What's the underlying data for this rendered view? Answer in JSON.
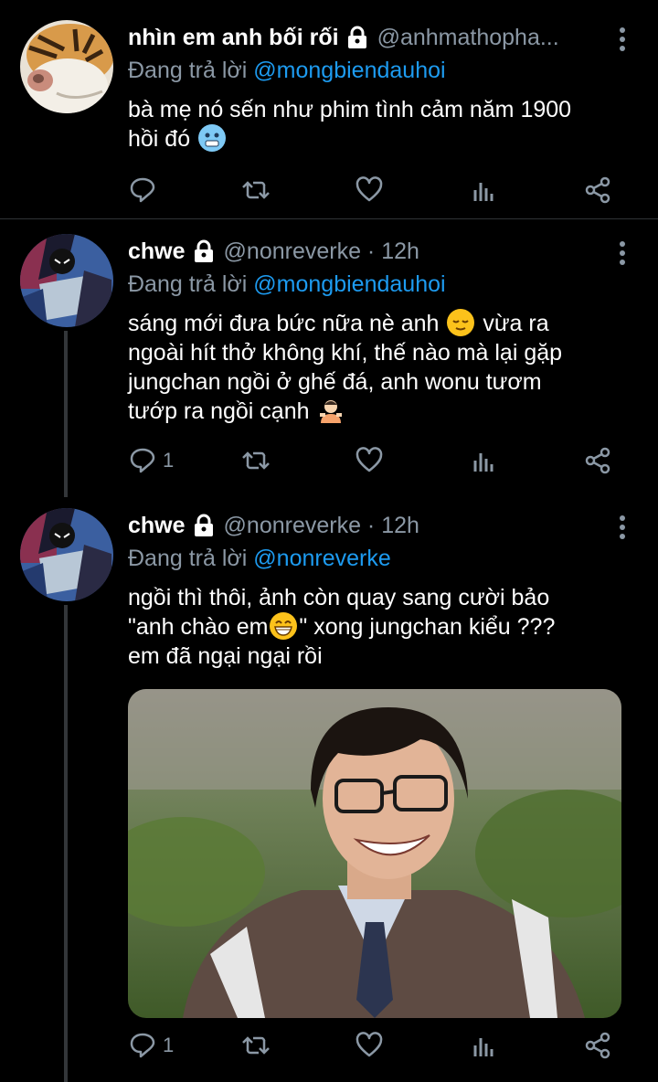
{
  "tweets": [
    {
      "name": "nhìn em anh bối rối",
      "handle": "@anhmathopha...",
      "time": "",
      "reply_prefix": "Đang trả lời",
      "reply_to": "@mongbiendauhoi",
      "text_lines": [
        "bà mẹ nó sến như phim tình cảm năm 1900",
        "hồi đó"
      ],
      "emoji": "cold-face",
      "reply_count": "",
      "avatar": "tiger-avatar"
    },
    {
      "name": "chwe",
      "handle": "@nonreverke · 12h",
      "reply_prefix": "Đang trả lời",
      "reply_to": "@mongbiendauhoi",
      "text_lines": [
        "sáng mới đưa bức nữa nè anh",
        "vừa ra",
        "ngoài hít thở không khí, thế nào mà lại gặp",
        "jungchan ngồi ở ghế đá, anh wonu tươm",
        "tướp ra ngồi cạnh"
      ],
      "emojis": [
        "relieved-face",
        "person-pouting"
      ],
      "reply_count": "1",
      "avatar": "comic-avatar"
    },
    {
      "name": "chwe",
      "handle": "@nonreverke · 12h",
      "reply_prefix": "Đang trả lời",
      "reply_to": "@nonreverke",
      "text_lines": [
        "ngồi thì thôi, ảnh còn quay sang cười bảo",
        "\"anh chào em",
        "\" xong jungchan kiểu ???",
        "em đã ngại ngại rồi"
      ],
      "emoji": "grinning-face",
      "reply_count": "1",
      "avatar": "comic-avatar",
      "media": "photo-smiling-person"
    }
  ],
  "colors": {
    "background": "#000000",
    "text": "#ffffff",
    "secondary": "#8b98a5",
    "link": "#1d9bf0",
    "divider": "#2f3336"
  }
}
